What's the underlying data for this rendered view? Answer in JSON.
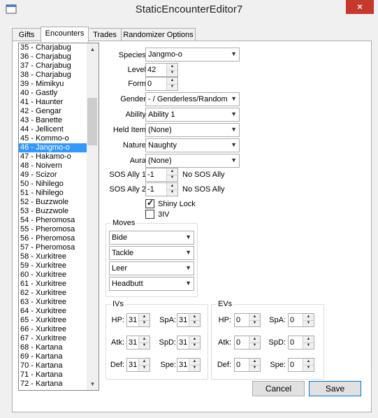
{
  "window": {
    "title": "StaticEncounterEditor7",
    "close_glyph": "×"
  },
  "tabs": [
    {
      "label": "Gifts"
    },
    {
      "label": "Encounters"
    },
    {
      "label": "Trades"
    },
    {
      "label": "Randomizer Options"
    }
  ],
  "encounter_list": [
    "35 - Charjabug",
    "36 - Charjabug",
    "37 - Charjabug",
    "38 - Charjabug",
    "39 - Mimikyu",
    "40 - Gastly",
    "41 - Haunter",
    "42 - Gengar",
    "43 - Banette",
    "44 - Jellicent",
    "45 - Kommo-o",
    "46 - Jangmo-o",
    "47 - Hakamo-o",
    "48 - Noivern",
    "49 - Scizor",
    "50 - Nihilego",
    "51 - Nihilego",
    "52 - Buzzwole",
    "53 - Buzzwole",
    "54 - Pheromosa",
    "55 - Pheromosa",
    "56 - Pheromosa",
    "57 - Pheromosa",
    "58 - Xurkitree",
    "59 - Xurkitree",
    "60 - Xurkitree",
    "61 - Xurkitree",
    "62 - Xurkitree",
    "63 - Xurkitree",
    "64 - Xurkitree",
    "65 - Xurkitree",
    "66 - Xurkitree",
    "67 - Xurkitree",
    "68 - Kartana",
    "69 - Kartana",
    "70 - Kartana",
    "71 - Kartana",
    "72 - Kartana"
  ],
  "selected_entry": "46 - Jangmo-o",
  "fields": {
    "species": {
      "label": "Species:",
      "value": "Jangmo-o"
    },
    "level": {
      "label": "Level:",
      "value": "42"
    },
    "form": {
      "label": "Form:",
      "value": "0"
    },
    "gender": {
      "label": "Gender:",
      "value": "- / Genderless/Random"
    },
    "ability": {
      "label": "Ability:",
      "value": "Ability 1"
    },
    "held_item": {
      "label": "Held Item:",
      "value": "(None)"
    },
    "nature": {
      "label": "Nature:",
      "value": "Naughty"
    },
    "aura": {
      "label": "Aura:",
      "value": "(None)"
    },
    "sos_ally_1": {
      "label": "SOS Ally 1:",
      "value": "-1",
      "desc": "No SOS Ally"
    },
    "sos_ally_2": {
      "label": "SOS Ally 2:",
      "value": "-1",
      "desc": "No SOS Ally"
    },
    "shiny_lock": {
      "label": "Shiny Lock",
      "checked": true,
      "check_glyph": "✓"
    },
    "three_iv": {
      "label": "3IV",
      "checked": false
    }
  },
  "moves": {
    "title": "Moves",
    "items": [
      "Bide",
      "Tackle",
      "Leer",
      "Headbutt"
    ]
  },
  "ivs": {
    "title": "IVs",
    "hp": {
      "label": "HP:",
      "value": "31"
    },
    "atk": {
      "label": "Atk:",
      "value": "31"
    },
    "def": {
      "label": "Def:",
      "value": "31"
    },
    "spa": {
      "label": "SpA:",
      "value": "31"
    },
    "spd": {
      "label": "SpD:",
      "value": "31"
    },
    "spe": {
      "label": "Spe:",
      "value": "31"
    }
  },
  "evs": {
    "title": "EVs",
    "hp": {
      "label": "HP:",
      "value": "0"
    },
    "atk": {
      "label": "Atk:",
      "value": "0"
    },
    "def": {
      "label": "Def:",
      "value": "0"
    },
    "spa": {
      "label": "SpA:",
      "value": "0"
    },
    "spd": {
      "label": "SpD:",
      "value": "0"
    },
    "spe": {
      "label": "Spe:",
      "value": "0"
    }
  },
  "buttons": {
    "cancel": "Cancel",
    "save": "Save"
  },
  "glyphs": {
    "dropdown": "▼",
    "spin_up": "▲",
    "spin_down": "▼",
    "scroll_up": "▲",
    "scroll_down": "▼"
  }
}
